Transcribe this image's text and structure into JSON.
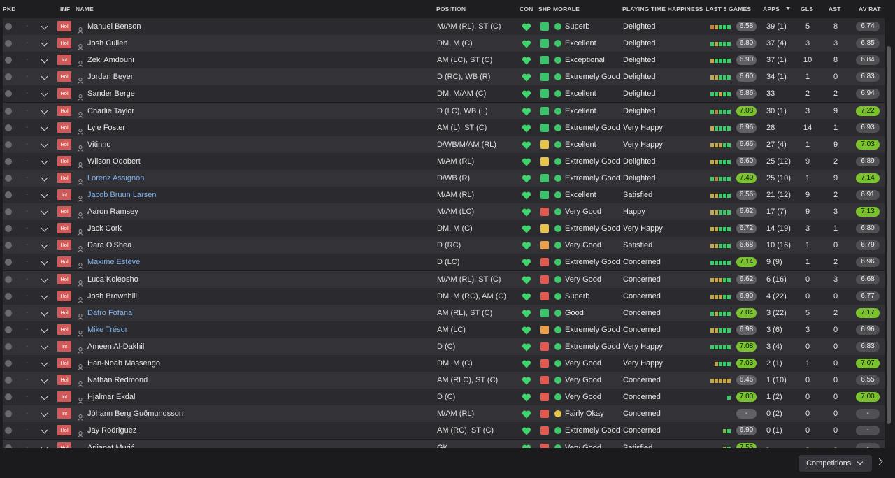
{
  "columns": {
    "pkd": "PKD",
    "inf": "INF",
    "name": "NAME",
    "position": "POSITION",
    "con": "CON",
    "shp": "SHP",
    "morale": "MORALE",
    "pth": "PLAYING TIME HAPPINESS",
    "last5": "LAST 5 GAMES",
    "apps": "APPS",
    "gls": "GLS",
    "ast": "AST",
    "avrat": "AV RAT"
  },
  "footer": {
    "competitions_label": "Competitions"
  },
  "icons": {
    "sort": "sort-desc-icon",
    "con": "heart-icon",
    "next": "chevron-right-icon"
  },
  "colors": {
    "inf_badge": "#d05a5a",
    "good": "#3fc86a",
    "highlight_rating": "#7ac22d",
    "link_name": "#7eb1ea"
  },
  "players": [
    {
      "inf": "Hol",
      "name": "Manuel Benson",
      "link": false,
      "position": "M/AM (RL), ST (C)",
      "shp": "g",
      "morale": "Superb",
      "pth": "Delighted",
      "last5": [
        "o",
        "y",
        "g",
        "g",
        "g"
      ],
      "last5_rating": "6.58",
      "last5_hi": false,
      "apps": "39 (1)",
      "gls": "5",
      "ast": "8",
      "av_rat": "6.74",
      "av_hi": false
    },
    {
      "inf": "Hol",
      "name": "Josh Cullen",
      "link": false,
      "position": "DM, M (C)",
      "shp": "g",
      "morale": "Excellent",
      "pth": "Delighted",
      "last5": [
        "g",
        "y",
        "g",
        "g",
        "g"
      ],
      "last5_rating": "6.80",
      "last5_hi": false,
      "apps": "37 (4)",
      "gls": "3",
      "ast": "3",
      "av_rat": "6.85",
      "av_hi": false
    },
    {
      "inf": "Int",
      "name": "Zeki Amdouni",
      "link": false,
      "position": "AM (LC), ST (C)",
      "shp": "g",
      "morale": "Exceptional",
      "pth": "Delighted",
      "last5": [
        "y",
        "g",
        "g",
        "g",
        "g"
      ],
      "last5_rating": "6.90",
      "last5_hi": false,
      "apps": "37 (1)",
      "gls": "10",
      "ast": "8",
      "av_rat": "6.84",
      "av_hi": false
    },
    {
      "inf": "Hol",
      "name": "Jordan Beyer",
      "link": false,
      "position": "D (RC), WB (R)",
      "shp": "g",
      "morale": "Extremely Good",
      "pth": "Delighted",
      "last5": [
        "y",
        "y",
        "g",
        "g",
        "g"
      ],
      "last5_rating": "6.60",
      "last5_hi": false,
      "apps": "34 (1)",
      "gls": "1",
      "ast": "0",
      "av_rat": "6.83",
      "av_hi": false
    },
    {
      "inf": "Hol",
      "name": "Sander Berge",
      "link": false,
      "position": "DM, M/AM (C)",
      "shp": "g",
      "morale": "Excellent",
      "pth": "Delighted",
      "last5": [
        "g",
        "g",
        "y",
        "g",
        "g"
      ],
      "last5_rating": "6.86",
      "last5_hi": false,
      "apps": "33",
      "gls": "2",
      "ast": "2",
      "av_rat": "6.94",
      "av_hi": false
    },
    {
      "inf": "Hol",
      "name": "Charlie Taylor",
      "link": false,
      "position": "D (LC), WB (L)",
      "shp": "g",
      "morale": "Excellent",
      "pth": "Delighted",
      "last5": [
        "g",
        "o",
        "g",
        "g",
        "g"
      ],
      "last5_rating": "7.08",
      "last5_hi": true,
      "apps": "30 (1)",
      "gls": "3",
      "ast": "9",
      "av_rat": "7.22",
      "av_hi": true
    },
    {
      "inf": "Hol",
      "name": "Lyle Foster",
      "link": false,
      "position": "AM (L), ST (C)",
      "shp": "g",
      "morale": "Extremely Good",
      "pth": "Very Happy",
      "last5": [
        "y",
        "g",
        "g",
        "g",
        "g"
      ],
      "last5_rating": "6.96",
      "last5_hi": false,
      "apps": "28",
      "gls": "14",
      "ast": "1",
      "av_rat": "6.93",
      "av_hi": false
    },
    {
      "inf": "Hol",
      "name": "Vitinho",
      "link": false,
      "position": "D/WB/M/AM (RL)",
      "shp": "y",
      "morale": "Excellent",
      "pth": "Very Happy",
      "last5": [
        "y",
        "y",
        "y",
        "g",
        "g"
      ],
      "last5_rating": "6.66",
      "last5_hi": false,
      "apps": "27 (4)",
      "gls": "1",
      "ast": "9",
      "av_rat": "7.03",
      "av_hi": true
    },
    {
      "inf": "Hol",
      "name": "Wilson Odobert",
      "link": false,
      "position": "M/AM (RL)",
      "shp": "y",
      "morale": "Extremely Good",
      "pth": "Delighted",
      "last5": [
        "y",
        "y",
        "g",
        "g",
        "g"
      ],
      "last5_rating": "6.60",
      "last5_hi": false,
      "apps": "25 (12)",
      "gls": "9",
      "ast": "2",
      "av_rat": "6.89",
      "av_hi": false
    },
    {
      "inf": "Hol",
      "name": "Lorenz Assignon",
      "link": true,
      "position": "D/WB (R)",
      "shp": "g",
      "morale": "Extremely Good",
      "pth": "Delighted",
      "last5": [
        "g",
        "o",
        "g",
        "g",
        "g"
      ],
      "last5_rating": "7.40",
      "last5_hi": true,
      "apps": "25 (10)",
      "gls": "1",
      "ast": "9",
      "av_rat": "7.14",
      "av_hi": true
    },
    {
      "inf": "Int",
      "name": "Jacob Bruun Larsen",
      "link": true,
      "position": "M/AM (RL)",
      "shp": "g",
      "morale": "Excellent",
      "pth": "Satisfied",
      "last5": [
        "y",
        "y",
        "g",
        "g",
        "g"
      ],
      "last5_rating": "6.56",
      "last5_hi": false,
      "apps": "21 (12)",
      "gls": "9",
      "ast": "2",
      "av_rat": "6.91",
      "av_hi": false
    },
    {
      "inf": "Hol",
      "name": "Aaron Ramsey",
      "link": false,
      "position": "M/AM (LC)",
      "shp": "r",
      "morale": "Very Good",
      "pth": "Happy",
      "last5": [
        "y",
        "y",
        "g",
        "g",
        "g"
      ],
      "last5_rating": "6.62",
      "last5_hi": false,
      "apps": "17 (7)",
      "gls": "9",
      "ast": "3",
      "av_rat": "7.13",
      "av_hi": true
    },
    {
      "inf": "Hol",
      "name": "Jack Cork",
      "link": false,
      "position": "DM, M (C)",
      "shp": "y",
      "morale": "Extremely Good",
      "pth": "Very Happy",
      "last5": [
        "y",
        "y",
        "g",
        "g",
        "g"
      ],
      "last5_rating": "6.72",
      "last5_hi": false,
      "apps": "14 (19)",
      "gls": "3",
      "ast": "1",
      "av_rat": "6.80",
      "av_hi": false
    },
    {
      "inf": "Hol",
      "name": "Dara O'Shea",
      "link": false,
      "position": "D (RC)",
      "shp": "o",
      "morale": "Very Good",
      "pth": "Satisfied",
      "last5": [
        "y",
        "y",
        "g",
        "g",
        "g"
      ],
      "last5_rating": "6.68",
      "last5_hi": false,
      "apps": "10 (16)",
      "gls": "1",
      "ast": "0",
      "av_rat": "6.79",
      "av_hi": false
    },
    {
      "inf": "Hol",
      "name": "Maxime Estève",
      "link": true,
      "position": "D (LC)",
      "shp": "r",
      "morale": "Extremely Good",
      "pth": "Concerned",
      "last5": [
        "g",
        "g",
        "g",
        "g",
        "g"
      ],
      "last5_rating": "7.14",
      "last5_hi": true,
      "apps": "9 (9)",
      "gls": "1",
      "ast": "2",
      "av_rat": "6.96",
      "av_hi": false
    },
    {
      "inf": "Hol",
      "name": "Luca Koleosho",
      "link": false,
      "position": "M/AM (RL), ST (C)",
      "shp": "r",
      "morale": "Very Good",
      "pth": "Concerned",
      "last5": [
        "y",
        "y",
        "y",
        "g",
        "g"
      ],
      "last5_rating": "6.62",
      "last5_hi": false,
      "apps": "6 (16)",
      "gls": "0",
      "ast": "3",
      "av_rat": "6.68",
      "av_hi": false
    },
    {
      "inf": "Hol",
      "name": "Josh Brownhill",
      "link": false,
      "position": "DM, M (RC), AM (C)",
      "shp": "r",
      "morale": "Superb",
      "pth": "Concerned",
      "last5": [
        "y",
        "y",
        "y",
        "g",
        "g"
      ],
      "last5_rating": "6.90",
      "last5_hi": false,
      "apps": "4 (22)",
      "gls": "0",
      "ast": "0",
      "av_rat": "6.77",
      "av_hi": false
    },
    {
      "inf": "Hol",
      "name": "Datro Fofana",
      "link": true,
      "position": "AM (RL), ST (C)",
      "shp": "g",
      "morale": "Good",
      "pth": "Concerned",
      "last5": [
        "g",
        "y",
        "g",
        "g",
        "g"
      ],
      "last5_rating": "7.04",
      "last5_hi": true,
      "apps": "3 (22)",
      "gls": "5",
      "ast": "2",
      "av_rat": "7.17",
      "av_hi": true
    },
    {
      "inf": "Hol",
      "name": "Mike Trésor",
      "link": true,
      "position": "AM (LC)",
      "shp": "o",
      "morale": "Extremely Good",
      "pth": "Concerned",
      "last5": [
        "y",
        "y",
        "g",
        "g",
        "g"
      ],
      "last5_rating": "6.98",
      "last5_hi": false,
      "apps": "3 (6)",
      "gls": "3",
      "ast": "0",
      "av_rat": "6.96",
      "av_hi": false
    },
    {
      "inf": "Int",
      "name": "Ameen Al-Dakhil",
      "link": false,
      "position": "D (C)",
      "shp": "r",
      "morale": "Extremely Good",
      "pth": "Very Happy",
      "last5": [
        "g",
        "g",
        "g",
        "g",
        "g"
      ],
      "last5_rating": "7.08",
      "last5_hi": true,
      "apps": "3 (4)",
      "gls": "0",
      "ast": "0",
      "av_rat": "6.83",
      "av_hi": false
    },
    {
      "inf": "Hol",
      "name": "Han-Noah Massengo",
      "link": false,
      "position": "DM, M (C)",
      "shp": "r",
      "morale": "Very Good",
      "pth": "Very Happy",
      "last5": [
        "y",
        "g",
        "g",
        "g"
      ],
      "last5_rating": "7.03",
      "last5_hi": true,
      "apps": "2 (1)",
      "gls": "1",
      "ast": "0",
      "av_rat": "7.07",
      "av_hi": true
    },
    {
      "inf": "Hol",
      "name": "Nathan Redmond",
      "link": false,
      "position": "AM (RLC), ST (C)",
      "shp": "r",
      "morale": "Very Good",
      "pth": "Concerned",
      "last5": [
        "y",
        "y",
        "y",
        "y",
        "y"
      ],
      "last5_rating": "6.46",
      "last5_hi": false,
      "apps": "1 (10)",
      "gls": "0",
      "ast": "0",
      "av_rat": "6.55",
      "av_hi": false
    },
    {
      "inf": "Int",
      "name": "Hjalmar Ekdal",
      "link": false,
      "position": "D (C)",
      "shp": "r",
      "morale": "Very Good",
      "pth": "Concerned",
      "last5": [
        "g"
      ],
      "last5_rating": "7.00",
      "last5_hi": true,
      "apps": "1 (2)",
      "gls": "0",
      "ast": "0",
      "av_rat": "7.00",
      "av_hi": true
    },
    {
      "inf": "Int",
      "name": "Jóhann Berg Guðmundsson",
      "link": false,
      "position": "M/AM (RL)",
      "shp": "r",
      "morale": "Fairly Okay",
      "morale_warn": true,
      "pth": "Concerned",
      "last5": [],
      "last5_rating": "-",
      "last5_hi": false,
      "apps": "0 (2)",
      "gls": "0",
      "ast": "0",
      "av_rat": "-",
      "av_hi": false
    },
    {
      "inf": "Hol",
      "name": "Jay Rodriguez",
      "link": false,
      "position": "AM (RC), ST (C)",
      "shp": "r",
      "morale": "Extremely Good",
      "pth": "Concerned",
      "last5": [
        "l",
        "g"
      ],
      "last5_rating": "6.90",
      "last5_hi": false,
      "apps": "0 (1)",
      "gls": "0",
      "ast": "0",
      "av_rat": "-",
      "av_hi": false
    },
    {
      "inf": "Hol",
      "name": "Arijanet Murić",
      "link": false,
      "position": "GK",
      "shp": "r",
      "morale": "Very Good",
      "pth": "Satisfied",
      "last5": [
        "l",
        "g"
      ],
      "last5_rating": "7.55",
      "last5_hi": true,
      "apps": "-",
      "gls": "-",
      "ast": "-",
      "av_rat": "-",
      "av_hi": false
    }
  ]
}
